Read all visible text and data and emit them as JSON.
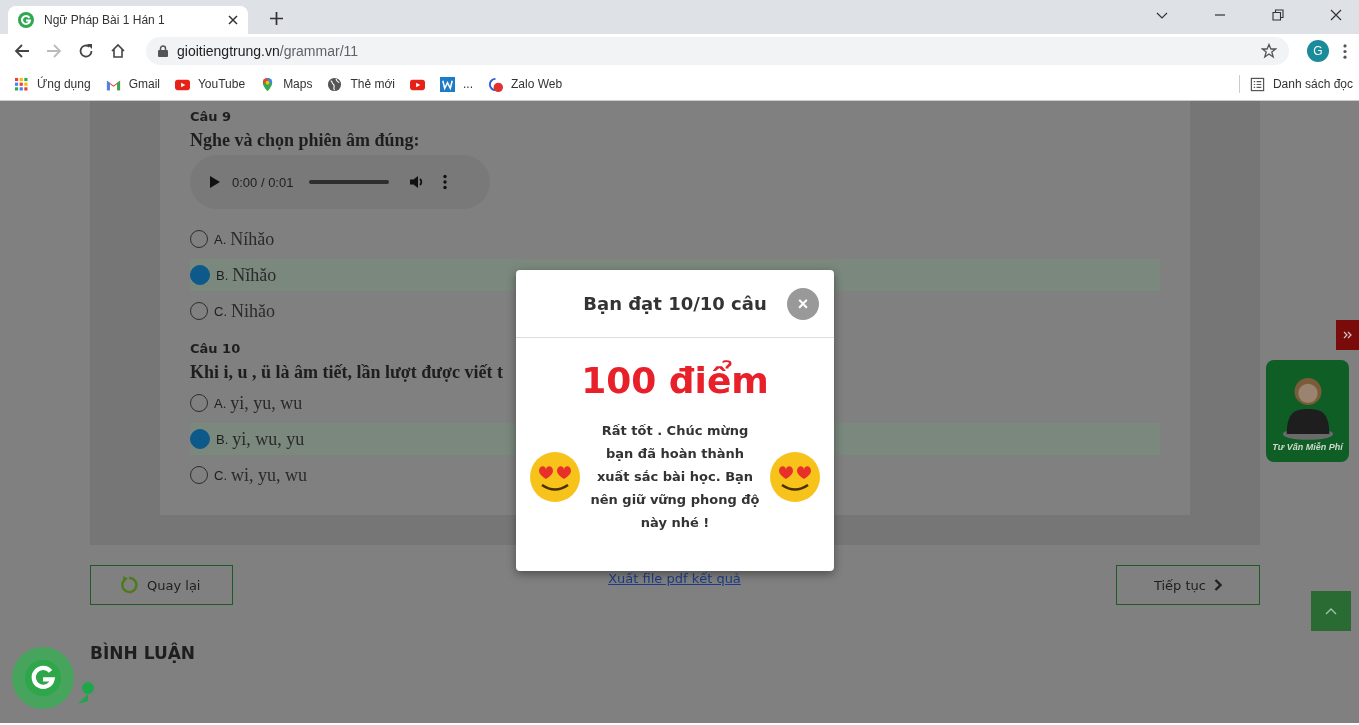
{
  "browser": {
    "tab_title": "Ngữ Pháp Bài 1 Hán 1",
    "url_host": "gioitiengtrung.vn",
    "url_path": "/grammar/11",
    "profile_initial": "G",
    "bookmarks": [
      {
        "kind": "apps",
        "label": "Ứng dụng"
      },
      {
        "kind": "gmail",
        "label": "Gmail"
      },
      {
        "kind": "youtube",
        "label": "YouTube"
      },
      {
        "kind": "maps",
        "label": "Maps"
      },
      {
        "kind": "globe",
        "label": "Thẻ mới"
      },
      {
        "kind": "youtube"
      },
      {
        "kind": "word",
        "label": "..."
      },
      {
        "kind": "zalo",
        "label": "Zalo Web"
      }
    ],
    "reading_list": "Danh sách đọc"
  },
  "questions": [
    {
      "label": "Câu 9",
      "prompt": "Nghe và chọn phiên âm đúng:",
      "audio": {
        "time": "0:00 / 0:01",
        "level": 0
      },
      "options": [
        {
          "letter": "A.",
          "text": "Níhǎo",
          "selected": false
        },
        {
          "letter": "B.",
          "text": "Nǐhǎo",
          "selected": true
        },
        {
          "letter": "C.",
          "text": "Nihǎo",
          "selected": false
        }
      ]
    },
    {
      "label": "Câu 10",
      "prompt": "Khi i, u , ü là âm tiết, lần lượt được viết t",
      "options": [
        {
          "letter": "A.",
          "text": "yi, yu, wu",
          "selected": false
        },
        {
          "letter": "B.",
          "text": "yi, wu, yu",
          "selected": true
        },
        {
          "letter": "C.",
          "text": "wi, yu, wu",
          "selected": false
        }
      ]
    }
  ],
  "actions": {
    "back": "Quay lại",
    "export_link": "Xuất file pdf kết quả",
    "next": "Tiếp tục"
  },
  "comments_heading": "BÌNH LUẬN",
  "consult_widget": {
    "caption": "Tư Vấn Miễn Phí"
  },
  "modal": {
    "title": "Bạn đạt 10/10 câu",
    "close": "×",
    "score": "100 điểm",
    "message": "Rất tốt . Chúc mừng bạn đã hoàn thành xuất sắc bài học. Bạn nên giữ vững phong độ này nhé !"
  }
}
